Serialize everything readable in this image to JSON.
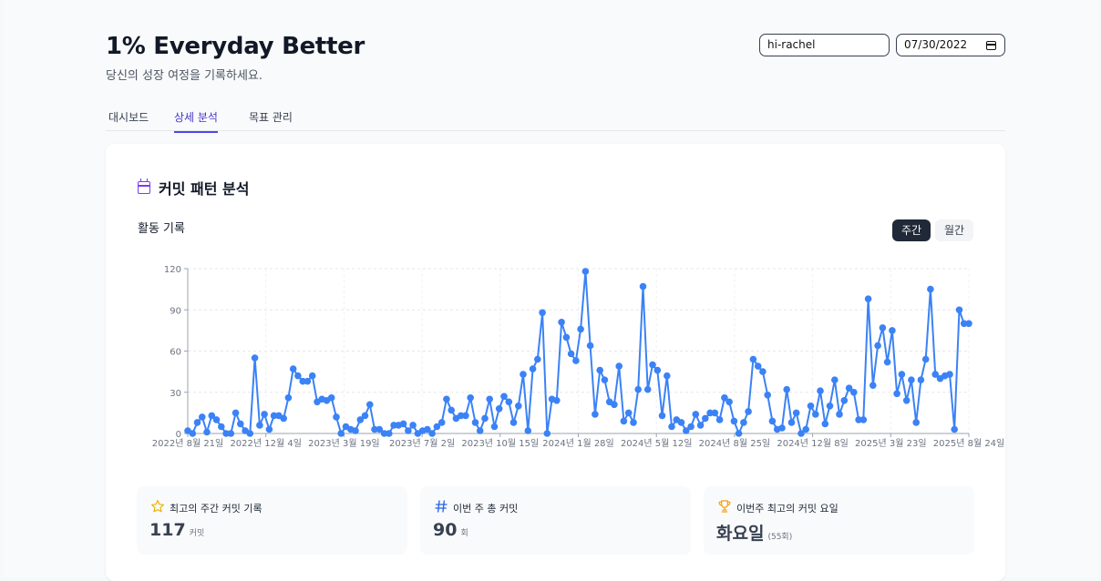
{
  "header": {
    "title": "1% Everyday Better",
    "subtitle": "당신의 성장 여정을 기록하세요."
  },
  "controls": {
    "username": "hi-rachel",
    "date": "07/30/2022"
  },
  "tabs": [
    {
      "label": "대시보드"
    },
    {
      "label": "상세 분석"
    },
    {
      "label": "목표 관리"
    }
  ],
  "card": {
    "title": "커밋 패턴 분석",
    "section": "활동 기록",
    "toggle": {
      "weekly": "주간",
      "monthly": "월간"
    }
  },
  "stats": [
    {
      "label": "최고의 주간 커밋 기록",
      "value": "117",
      "unit": "커밋",
      "icon": "star-icon"
    },
    {
      "label": "이번 주 총 커밋",
      "value": "90",
      "unit": "회",
      "icon": "hash-icon"
    },
    {
      "label": "이번주 최고의 커밋 요일",
      "value": "화요일",
      "unit": "(55회)",
      "icon": "trophy-icon"
    }
  ],
  "colors": {
    "accent": "#4f46e5",
    "line": "#3b82f6",
    "star": "#eab308",
    "hash": "#2563eb",
    "trophy": "#f59e0b",
    "calendar": "#7c3aed"
  },
  "chart_data": {
    "type": "line",
    "x_tick_labels": [
      "2022년 8월 21일",
      "2022년 12월 4일",
      "2023년 3월 19일",
      "2023년 7월 2일",
      "2023년 10월 15일",
      "2024년 1월 28일",
      "2024년 5월 12일",
      "2024년 8월 25일",
      "2024년 12월 8일",
      "2025년 3월 23일",
      "2025년 8월 24일"
    ],
    "y_ticks": [
      0,
      30,
      60,
      90,
      120
    ],
    "ylim": [
      0,
      120
    ],
    "grid": true,
    "series": [
      {
        "values": [
          2,
          0,
          8,
          12,
          1,
          13,
          10,
          5,
          0,
          0,
          15,
          7,
          2,
          0,
          55,
          6,
          14,
          3,
          13,
          13,
          11,
          26,
          47,
          42,
          38,
          38,
          42,
          23,
          25,
          24,
          26,
          12,
          0,
          5,
          3,
          2,
          10,
          13,
          21,
          3,
          3,
          0,
          0,
          6,
          6,
          7,
          2,
          6,
          0,
          2,
          3,
          0,
          5,
          8,
          25,
          17,
          11,
          13,
          13,
          26,
          8,
          2,
          11,
          25,
          5,
          18,
          27,
          23,
          8,
          20,
          43,
          2,
          47,
          54,
          88,
          0,
          25,
          24,
          81,
          70,
          58,
          53,
          76,
          118,
          64,
          14,
          46,
          39,
          23,
          21,
          49,
          9,
          15,
          8,
          32,
          107,
          32,
          50,
          46,
          13,
          42,
          5,
          10,
          8,
          2,
          5,
          14,
          6,
          11,
          15,
          15,
          10,
          26,
          23,
          9,
          0,
          8,
          16,
          54,
          49,
          45,
          28,
          9,
          3,
          4,
          32,
          8,
          15,
          0,
          3,
          20,
          14,
          31,
          7,
          20,
          39,
          14,
          24,
          33,
          30,
          10,
          10,
          98,
          35,
          64,
          77,
          52,
          75,
          29,
          43,
          24,
          39,
          8,
          39,
          54,
          105,
          43,
          40,
          42,
          43,
          3,
          90,
          80,
          80
        ]
      }
    ]
  }
}
